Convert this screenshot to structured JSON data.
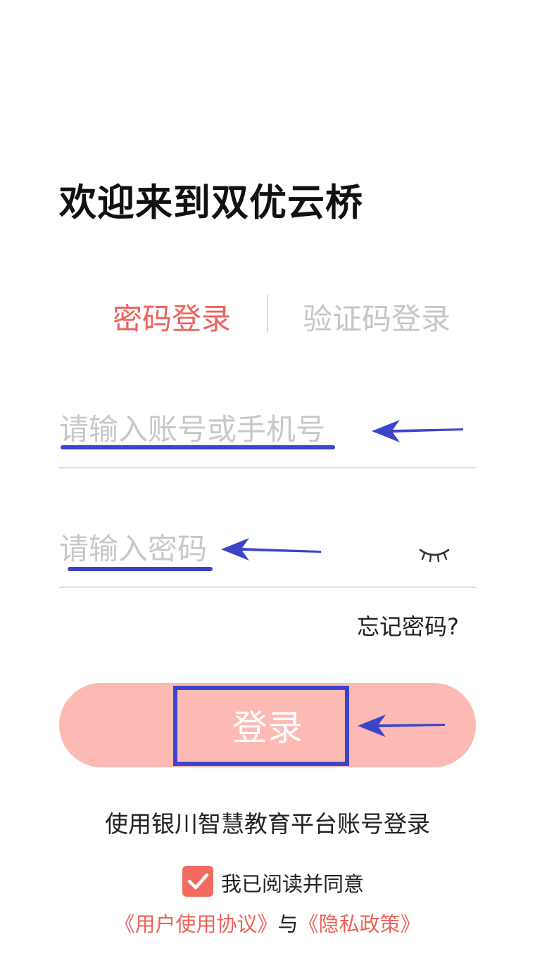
{
  "header": {
    "title": "欢迎来到双优云桥"
  },
  "tabs": [
    {
      "label": "密码登录",
      "active": true
    },
    {
      "label": "验证码登录",
      "active": false
    }
  ],
  "form": {
    "account_placeholder": "请输入账号或手机号",
    "account_value": "",
    "password_placeholder": "请输入密码",
    "password_value": "",
    "password_toggle_icon": "eye-closed-icon",
    "forgot_label": "忘记密码?",
    "login_label": "登录"
  },
  "footer": {
    "platform_text": "使用银川智慧教育平台账号登录",
    "agree_checked": true,
    "agree_text": "我已阅读并同意",
    "user_agreement": "《用户使用协议》",
    "conjunction": "与",
    "privacy_policy": "《隐私政策》"
  },
  "colors": {
    "accent": "#ee625a",
    "button_bg": "#fdbab4",
    "checkbox": "#f26a60",
    "annotation": "#3c45c8"
  }
}
